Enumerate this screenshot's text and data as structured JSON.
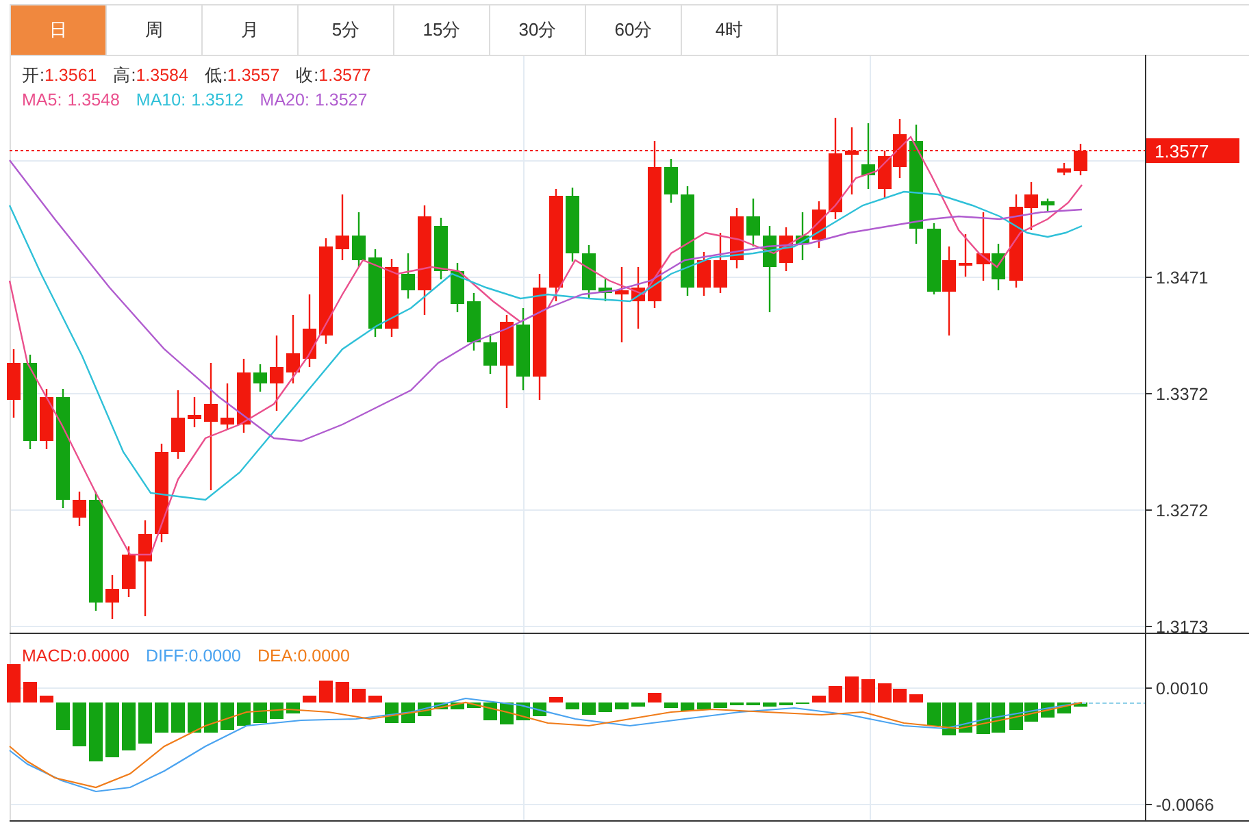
{
  "tabs": [
    {
      "label": "日",
      "selected": true
    },
    {
      "label": "周",
      "selected": false
    },
    {
      "label": "月",
      "selected": false
    },
    {
      "label": "5分",
      "selected": false
    },
    {
      "label": "15分",
      "selected": false
    },
    {
      "label": "30分",
      "selected": false
    },
    {
      "label": "60分",
      "selected": false
    },
    {
      "label": "4时",
      "selected": false
    }
  ],
  "quote": [
    {
      "label": "开:",
      "value": "1.3561"
    },
    {
      "label": "高:",
      "value": "1.3584"
    },
    {
      "label": "低:",
      "value": "1.3557"
    },
    {
      "label": "收:",
      "value": "1.3577"
    }
  ],
  "moving_averages": [
    {
      "label": "MA5:",
      "value": "1.3548",
      "color": "#ea4f8c"
    },
    {
      "label": "MA10:",
      "value": "1.3512",
      "color": "#2fc0d8"
    },
    {
      "label": "MA20:",
      "value": "1.3527",
      "color": "#b05ccf"
    }
  ],
  "main_chart": {
    "axis_labels": [
      "1.3471",
      "1.3372",
      "1.3272",
      "1.3173"
    ],
    "last_price": "1.3577"
  },
  "macd": {
    "legend": [
      {
        "label": "MACD:",
        "value": "0.0000",
        "color": "#f0261a"
      },
      {
        "label": "DIFF:",
        "value": "0.0000",
        "color": "#4aa3f0"
      },
      {
        "label": "DEA:",
        "value": "0.0000",
        "color": "#f07c1a"
      }
    ],
    "axis_labels": [
      "0.0010",
      "-0.0066"
    ]
  }
}
